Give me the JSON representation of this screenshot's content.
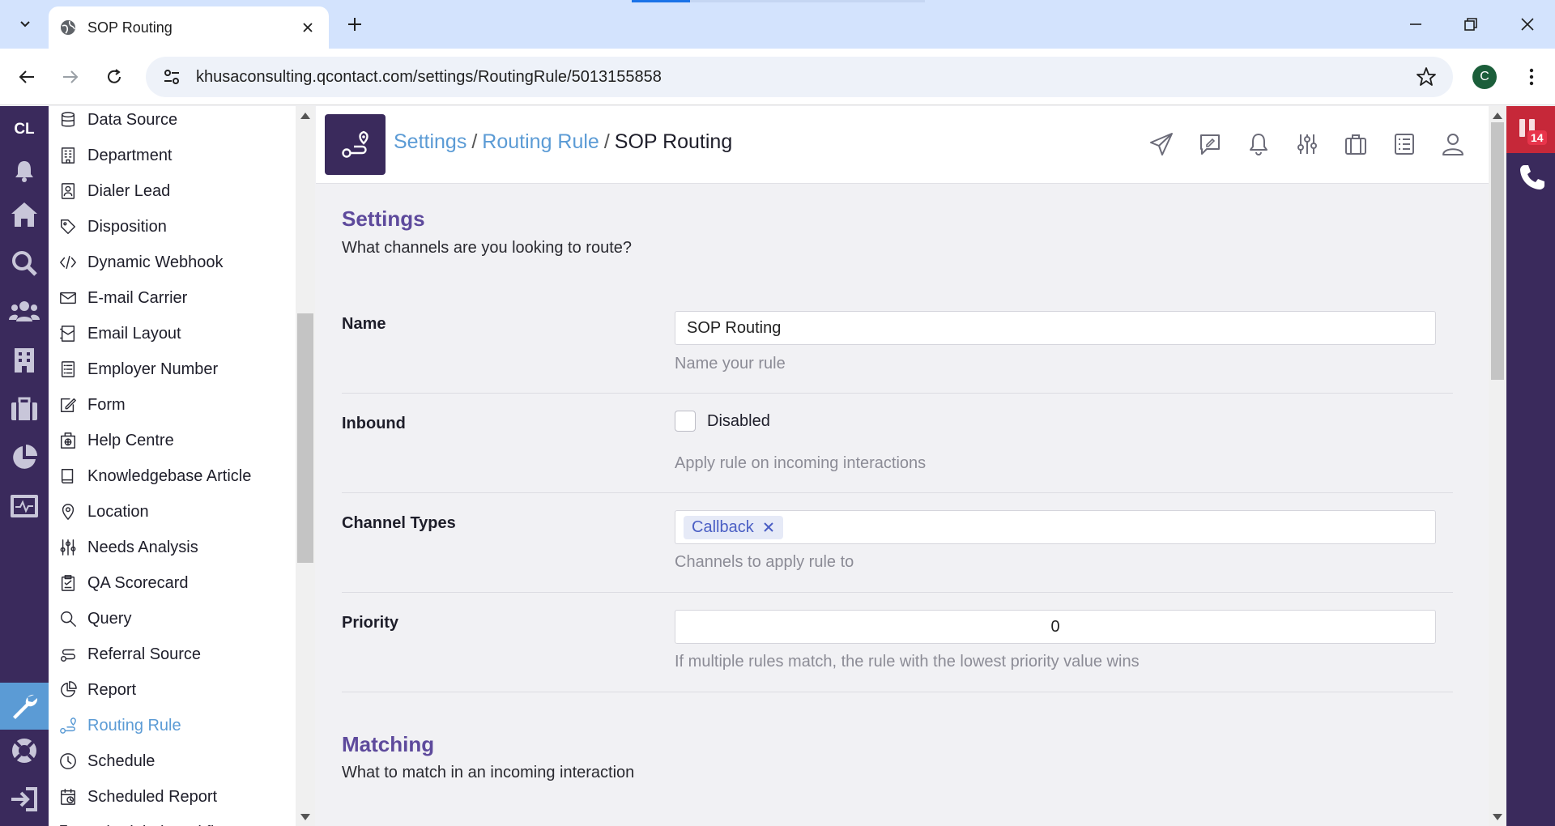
{
  "browser": {
    "tab_title": "SOP Routing",
    "url": "khusaconsulting.qcontact.com/settings/RoutingRule/5013155858",
    "profile_initial": "C"
  },
  "rail": {
    "brand": "CL"
  },
  "menu": {
    "items": [
      {
        "label": "Data Source",
        "icon": "database-icon"
      },
      {
        "label": "Department",
        "icon": "building-icon"
      },
      {
        "label": "Dialer Lead",
        "icon": "contact-card-icon"
      },
      {
        "label": "Disposition",
        "icon": "tag-icon"
      },
      {
        "label": "Dynamic Webhook",
        "icon": "code-icon"
      },
      {
        "label": "E-mail Carrier",
        "icon": "envelope-icon"
      },
      {
        "label": "Email Layout",
        "icon": "email-layout-icon"
      },
      {
        "label": "Employer Number",
        "icon": "list-icon"
      },
      {
        "label": "Form",
        "icon": "form-edit-icon"
      },
      {
        "label": "Help Centre",
        "icon": "help-centre-icon"
      },
      {
        "label": "Knowledgebase Article",
        "icon": "book-icon"
      },
      {
        "label": "Location",
        "icon": "map-pin-icon"
      },
      {
        "label": "Needs Analysis",
        "icon": "sliders-icon"
      },
      {
        "label": "QA Scorecard",
        "icon": "clipboard-icon"
      },
      {
        "label": "Query",
        "icon": "search-icon"
      },
      {
        "label": "Referral Source",
        "icon": "referral-icon"
      },
      {
        "label": "Report",
        "icon": "pie-chart-icon"
      },
      {
        "label": "Routing Rule",
        "icon": "route-icon"
      },
      {
        "label": "Schedule",
        "icon": "clock-icon"
      },
      {
        "label": "Scheduled Report",
        "icon": "calendar-clock-icon"
      },
      {
        "label": "Scheduled Workflow",
        "icon": "workflow-icon"
      }
    ],
    "active_label": "Routing Rule"
  },
  "header": {
    "crumb_settings": "Settings",
    "crumb_routing_rule": "Routing Rule",
    "crumb_current": "SOP Routing",
    "separator": "/"
  },
  "settings_section": {
    "title": "Settings",
    "subtitle": "What channels are you looking to route?"
  },
  "fields": {
    "name": {
      "label": "Name",
      "value": "SOP Routing",
      "help": "Name your rule"
    },
    "inbound": {
      "label": "Inbound",
      "checkbox_label": "Disabled",
      "checked": false,
      "help": "Apply rule on incoming interactions"
    },
    "channel_types": {
      "label": "Channel Types",
      "chips": [
        "Callback"
      ],
      "help": "Channels to apply rule to"
    },
    "priority": {
      "label": "Priority",
      "value": "0",
      "help": "If multiple rules match, the rule with the lowest priority value wins"
    }
  },
  "matching_section": {
    "title": "Matching",
    "subtitle": "What to match in an incoming interaction"
  },
  "phone_panel": {
    "badge_count": "14"
  },
  "colors": {
    "brand_purple": "#3a2a5c",
    "accent_blue": "#5b9bd5",
    "heading_purple": "#5e4a9c",
    "alert_red": "#c62839"
  }
}
